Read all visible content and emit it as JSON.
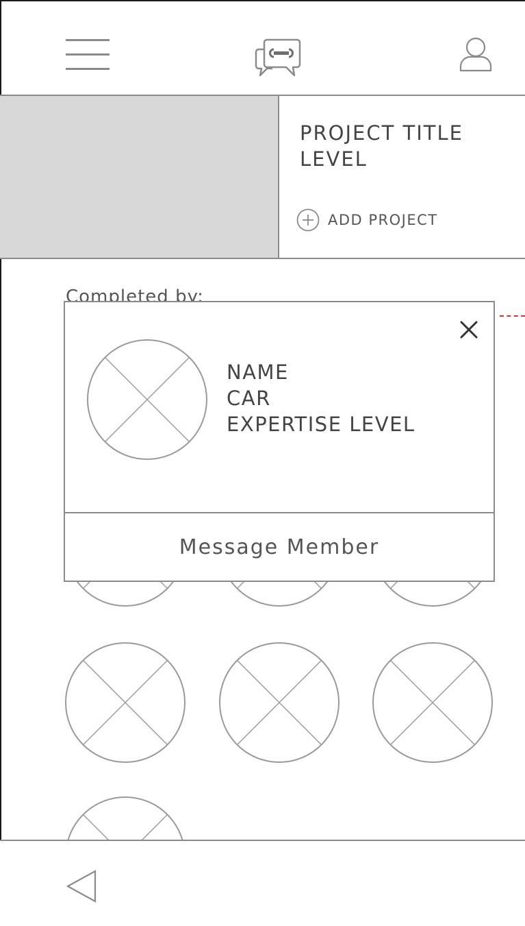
{
  "header": {
    "menu_icon": "hamburger-menu-icon",
    "logo_icon": "chat-wrench-logo-icon",
    "profile_icon": "user-profile-icon"
  },
  "project": {
    "image_alt": "project-image-placeholder",
    "title": "PROJECT TITLE",
    "level": "LEVEL",
    "add_label": "ADD PROJECT",
    "add_icon": "plus-circle-icon"
  },
  "members": {
    "heading": "Completed by:",
    "avatar_icon": "avatar-placeholder-icon",
    "count_rows": "3 visible rows"
  },
  "popup": {
    "name": "NAME",
    "car": "CAR",
    "expertise": "EXPERTISE LEVEL",
    "action_label": "Message Member",
    "close_icon": "close-icon"
  },
  "footer": {
    "back_icon": "back-triangle-icon"
  },
  "colors": {
    "line": "#8a8a8a",
    "image_fill": "#d8d8d8",
    "annotation": "#d0343a",
    "text": "#444444"
  }
}
